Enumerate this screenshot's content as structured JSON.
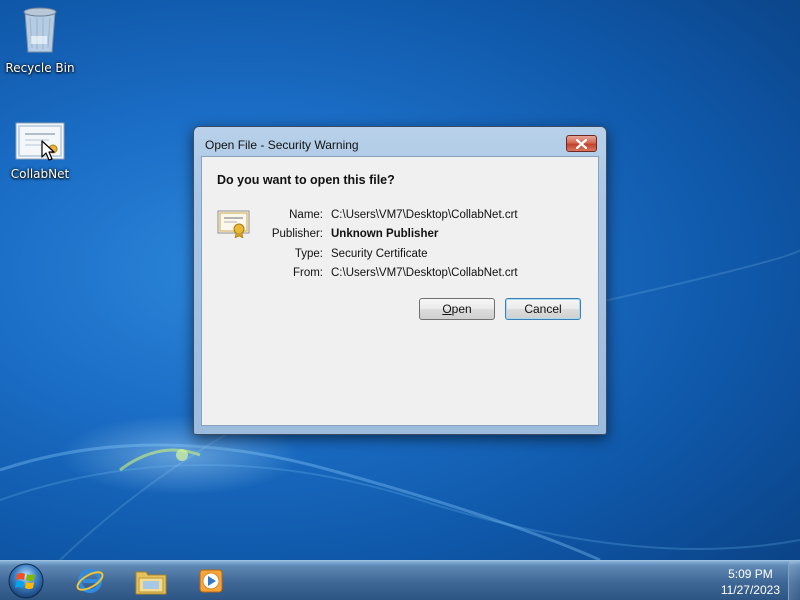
{
  "desktop": {
    "icons": [
      {
        "label": "Recycle Bin",
        "icon": "recycle-bin-icon"
      },
      {
        "label": "CollabNet",
        "icon": "certificate-file-icon"
      }
    ]
  },
  "dialog": {
    "title": "Open File - Security Warning",
    "question": "Do you want to open this file?",
    "fields": [
      {
        "key": "Name:",
        "value": "C:\\Users\\VM7\\Desktop\\CollabNet.crt"
      },
      {
        "key": "Publisher:",
        "value": "Unknown Publisher"
      },
      {
        "key": "Type:",
        "value": "Security Certificate"
      },
      {
        "key": "From:",
        "value": "C:\\Users\\VM7\\Desktop\\CollabNet.crt"
      }
    ],
    "open_label_mnemonic": "O",
    "open_label_rest": "pen",
    "cancel_label": "Cancel"
  },
  "taskbar": {
    "pinned": [
      "internet-explorer-icon",
      "windows-explorer-icon",
      "media-player-icon"
    ],
    "clock_time": "5:09 PM",
    "clock_date": "11/27/2023"
  },
  "colors": {
    "desktop_blue": "#1a6cc4",
    "dialog_frame": "#a9c6e4",
    "close_red": "#c4412b",
    "default_button_border": "#3c7fb1"
  }
}
